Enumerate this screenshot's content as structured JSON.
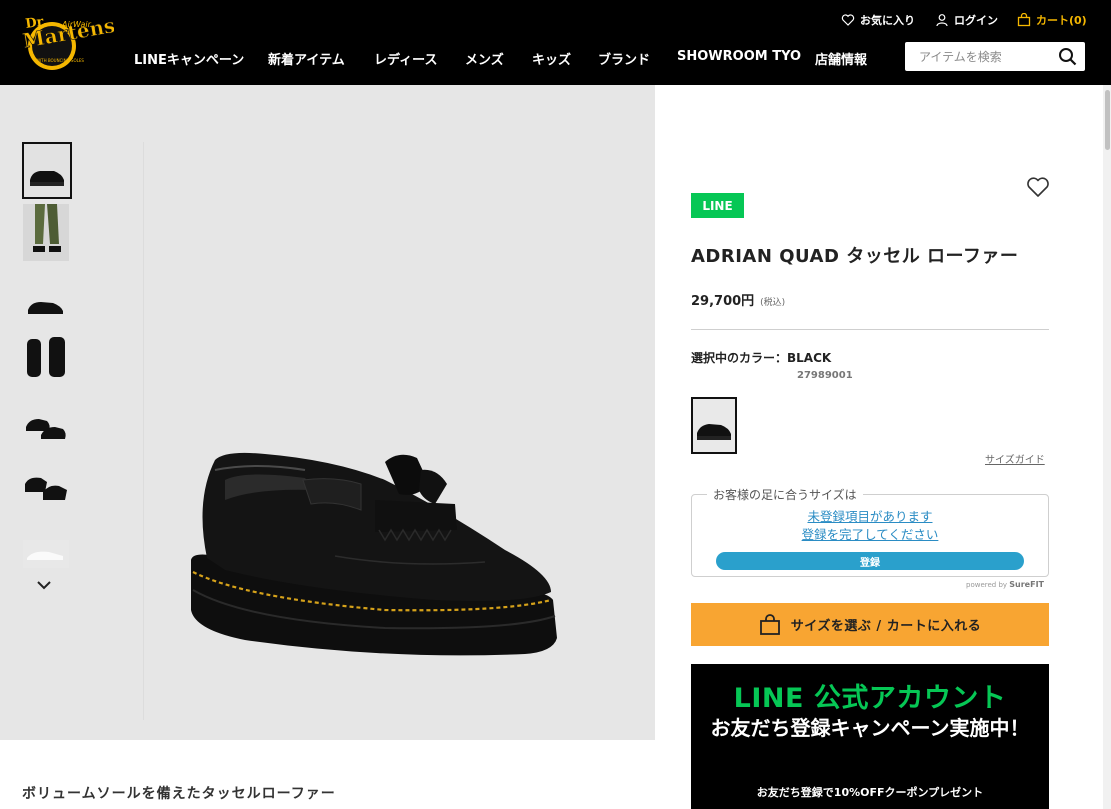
{
  "header": {
    "logo_text": "Dr. Martens AirWair",
    "util": {
      "favorites": "お気に入り",
      "login": "ログイン",
      "cart": "カート(0)"
    },
    "nav": [
      "LINEキャンペーン",
      "新着アイテム",
      "レディース",
      "メンズ",
      "キッズ",
      "ブランド",
      "SHOWROOM TYO",
      "店舗情報"
    ],
    "search": {
      "placeholder": "アイテムを検索"
    }
  },
  "gallery": {
    "thumbnails": [
      "loafer-side",
      "model-legs",
      "loafer-small",
      "loafer-pair-front",
      "loafer-pair-angle",
      "loafer-pair-top",
      "loafer-sole"
    ],
    "active_index": 0
  },
  "tagline": "ボリュームソールを備えたタッセルローファー",
  "product": {
    "badge": "LINE",
    "title": "ADRIAN QUAD タッセル ローファー",
    "price": "29,700円",
    "tax_note": "(税込)",
    "color_label": "選択中のカラー：BLACK",
    "sku": "27989001",
    "size_guide": "サイズガイド",
    "surefit": {
      "legend": "お客様の足に合うサイズは",
      "link1": "未登録項目があります",
      "link2": "登録を完了してください",
      "button": "登録",
      "powered_prefix": "powered by",
      "powered_brand": "SureFIT"
    },
    "cart_button": "サイズを選ぶ / カートに入れる"
  },
  "line_banner": {
    "title": "LINE 公式アカウント",
    "subtitle": "お友だち登録キャンペーン実施中！",
    "note": "お友だち登録で10%OFFクーポンプレゼント"
  },
  "colors": {
    "header_bg": "#000000",
    "accent_yellow": "#f5b700",
    "line_green": "#06c755",
    "cart_orange": "#f8a532",
    "surefit_blue": "#2aa0cc"
  }
}
